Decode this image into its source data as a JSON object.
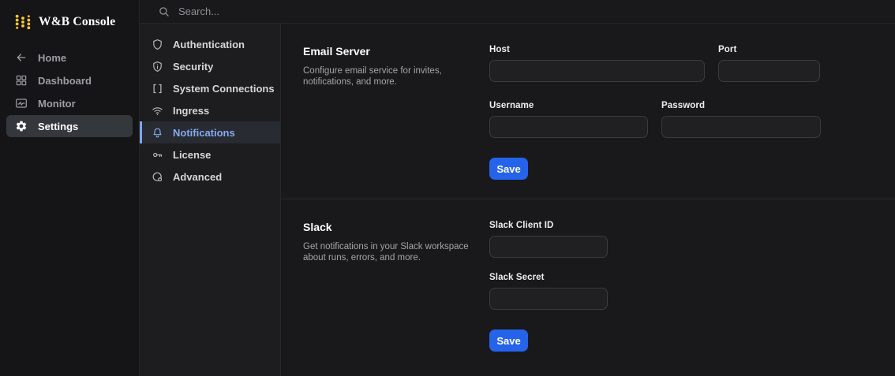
{
  "app": {
    "title": "W&B Console"
  },
  "topbar": {
    "search_placeholder": "Search..."
  },
  "sidebar": {
    "items": [
      {
        "label": "Home",
        "icon": "arrow-left",
        "selected": false
      },
      {
        "label": "Dashboard",
        "icon": "dashboard-grid",
        "selected": false
      },
      {
        "label": "Monitor",
        "icon": "monitor-chart",
        "selected": false
      },
      {
        "label": "Settings",
        "icon": "gear",
        "selected": true
      }
    ]
  },
  "settings_nav": {
    "items": [
      {
        "label": "Authentication",
        "icon": "shield",
        "selected": false
      },
      {
        "label": "Security",
        "icon": "shield-info",
        "selected": false
      },
      {
        "label": "System Connections",
        "icon": "brackets",
        "selected": false
      },
      {
        "label": "Ingress",
        "icon": "wifi",
        "selected": false
      },
      {
        "label": "Notifications",
        "icon": "bell",
        "selected": true
      },
      {
        "label": "License",
        "icon": "key",
        "selected": false
      },
      {
        "label": "Advanced",
        "icon": "advanced-circle",
        "selected": false
      }
    ]
  },
  "email_section": {
    "title": "Email Server",
    "description": "Configure email service for invites, notifications, and more.",
    "fields": {
      "host": {
        "label": "Host",
        "value": ""
      },
      "port": {
        "label": "Port",
        "value": ""
      },
      "username": {
        "label": "Username",
        "value": ""
      },
      "password": {
        "label": "Password",
        "value": ""
      }
    },
    "save_label": "Save"
  },
  "slack_section": {
    "title": "Slack",
    "description": "Get notifications in your Slack workspace about runs, errors, and more.",
    "fields": {
      "client_id": {
        "label": "Slack Client ID",
        "value": ""
      },
      "secret": {
        "label": "Slack Secret",
        "value": ""
      }
    },
    "save_label": "Save"
  },
  "colors": {
    "accent_blue": "#2563eb",
    "selected_nav_blue": "#84abf3",
    "brand_gold": "#ffc933",
    "background": "#19191b"
  }
}
